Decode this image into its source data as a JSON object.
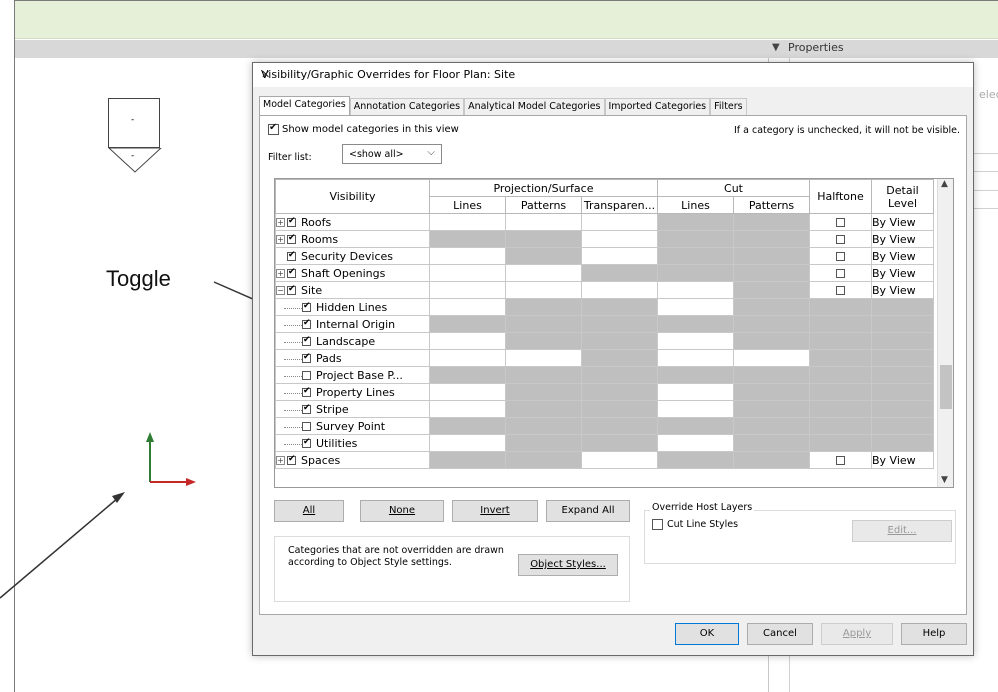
{
  "app": {
    "properties_label": "Properties",
    "properties_cut_text": "elec"
  },
  "elevation_marker": {
    "top_label": "-",
    "bottom_label": "-"
  },
  "annotation": {
    "toggle_label": "Toggle"
  },
  "dialog": {
    "title": "Visibility/Graphic Overrides for Floor Plan: Site",
    "close_label": "✕",
    "tabs": [
      "Model Categories",
      "Annotation Categories",
      "Analytical Model Categories",
      "Imported Categories",
      "Filters"
    ],
    "show_model_label": "Show model categories in this view",
    "hint": "If a category is unchecked, it will not be visible.",
    "filter_label": "Filter list:",
    "filter_value": "<show all>",
    "columns": {
      "visibility": "Visibility",
      "projection_surface": "Projection/Surface",
      "cut": "Cut",
      "halftone": "Halftone",
      "detail_level": "Detail Level",
      "lines": "Lines",
      "patterns": "Patterns",
      "transparency": "Transparen...",
      "cut_lines": "Lines",
      "cut_patterns": "Patterns"
    },
    "rows": [
      {
        "name": "Roofs",
        "level": 0,
        "expander": "+",
        "checked": true,
        "detail": "By View"
      },
      {
        "name": "Rooms",
        "level": 0,
        "expander": "+",
        "checked": true,
        "detail": "By View"
      },
      {
        "name": "Security Devices",
        "level": 0,
        "expander": "",
        "checked": true,
        "detail": "By View"
      },
      {
        "name": "Shaft Openings",
        "level": 0,
        "expander": "+",
        "checked": true,
        "detail": "By View"
      },
      {
        "name": "Site",
        "level": 0,
        "expander": "−",
        "checked": true,
        "detail": "By View"
      },
      {
        "name": "Hidden Lines",
        "level": 1,
        "expander": "",
        "checked": true,
        "detail": ""
      },
      {
        "name": "Internal Origin",
        "level": 1,
        "expander": "",
        "checked": true,
        "detail": ""
      },
      {
        "name": "Landscape",
        "level": 1,
        "expander": "",
        "checked": true,
        "detail": ""
      },
      {
        "name": "Pads",
        "level": 1,
        "expander": "",
        "checked": true,
        "detail": ""
      },
      {
        "name": "Project Base P...",
        "level": 1,
        "expander": "",
        "checked": false,
        "detail": ""
      },
      {
        "name": "Property Lines",
        "level": 1,
        "expander": "",
        "checked": true,
        "detail": ""
      },
      {
        "name": "Stripe",
        "level": 1,
        "expander": "",
        "checked": true,
        "detail": ""
      },
      {
        "name": "Survey Point",
        "level": 1,
        "expander": "",
        "checked": false,
        "detail": ""
      },
      {
        "name": "Utilities",
        "level": 1,
        "expander": "",
        "checked": true,
        "detail": ""
      },
      {
        "name": "Spaces",
        "level": 0,
        "expander": "+",
        "checked": true,
        "detail": "By View"
      }
    ],
    "buttons": {
      "all": "All",
      "none": "None",
      "invert": "Invert",
      "expand_all": "Expand All",
      "object_styles": "Object Styles...",
      "edit": "Edit...",
      "ok": "OK",
      "cancel": "Cancel",
      "apply": "Apply",
      "help": "Help"
    },
    "override_host_layers": "Override Host Layers",
    "cut_line_styles": "Cut Line Styles",
    "note": "Categories that are not overridden are drawn according to Object Style settings."
  }
}
